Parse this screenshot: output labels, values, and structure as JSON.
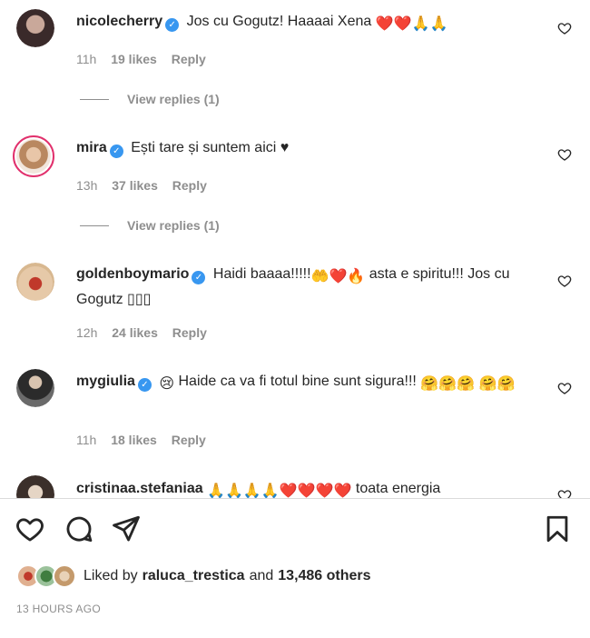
{
  "comments": [
    {
      "username": "nicolecherry",
      "text": "Jos cu Gogutz! Haaaai Xena",
      "emoji": "❤️❤️🙏🙏",
      "time": "11h",
      "likes": "19 likes",
      "reply": "Reply",
      "view_replies": "View replies (1)"
    },
    {
      "username": "mira",
      "text": "Ești tare și suntem aici",
      "emoji": "♥",
      "time": "13h",
      "likes": "37 likes",
      "reply": "Reply",
      "view_replies": "View replies (1)"
    },
    {
      "username": "goldenboymario",
      "text": "Haidi baaaa!!!!!",
      "emoji": "🤲❤️🔥",
      "text2": "asta e spiritu!!! Jos cu Gogutz",
      "text3": "▯▯▯",
      "time": "12h",
      "likes": "24 likes",
      "reply": "Reply"
    },
    {
      "username": "mygiulia",
      "emoji": "😢",
      "text": "Haide ca va fi totul bine sunt sigura!!!",
      "emoji2": "🤗🤗🤗",
      "emoji3": "🤗🤗",
      "time": "11h",
      "likes": "18 likes",
      "reply": "Reply"
    },
    {
      "username": "cristinaa.stefaniaa",
      "emoji": "🙏🙏🙏🙏❤️❤️❤️❤️",
      "text": "toata energia"
    }
  ],
  "liked_by": {
    "prefix": "Liked by",
    "user": "raluca_trestica",
    "middle": "and",
    "count": "13,486 others"
  },
  "timestamp": "13 HOURS AGO",
  "icons": {
    "verified": "verified-badge-icon",
    "comment_like": "heart-outline-icon",
    "like": "heart-outline-icon",
    "comment": "comment-bubble-icon",
    "share": "paper-plane-icon",
    "save": "bookmark-icon"
  },
  "colors": {
    "verified": "#3897f0",
    "muted": "#8e8e8e",
    "text": "#262626",
    "story_ring": "#e1306c"
  }
}
